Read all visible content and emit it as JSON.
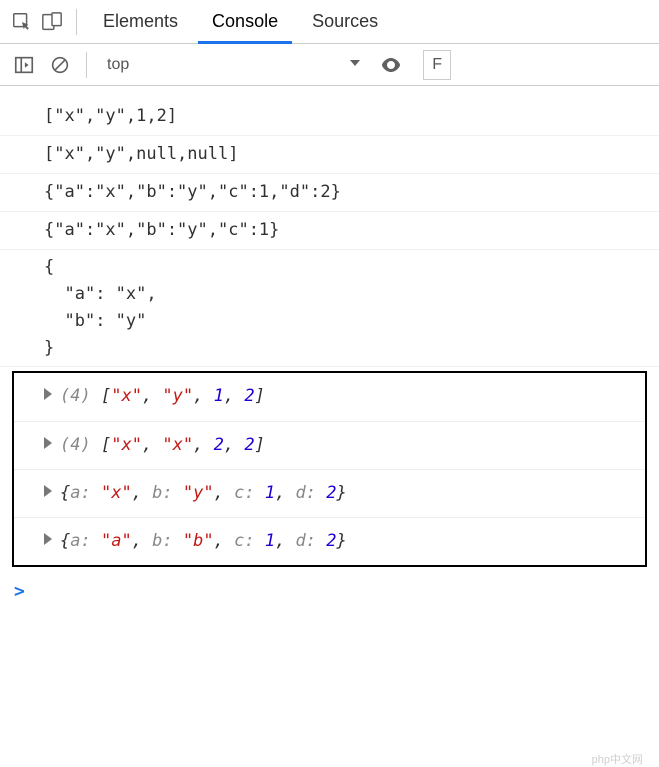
{
  "tabs": {
    "elements": "Elements",
    "console": "Console",
    "sources": "Sources"
  },
  "toolbar": {
    "context": "top",
    "filter_label": "F"
  },
  "logs": [
    "[\"x\",\"y\",1,2]",
    "[\"x\",\"y\",null,null]",
    "{\"a\":\"x\",\"b\":\"y\",\"c\":1,\"d\":2}",
    "{\"a\":\"x\",\"b\":\"y\",\"c\":1}",
    "{\n  \"a\": \"x\",\n  \"b\": \"y\"\n}"
  ],
  "boxed": [
    {
      "type": "array",
      "count": 4,
      "items": [
        {
          "v": "\"x\"",
          "t": "str"
        },
        {
          "v": "\"y\"",
          "t": "str"
        },
        {
          "v": "1",
          "t": "num"
        },
        {
          "v": "2",
          "t": "num"
        }
      ]
    },
    {
      "type": "array",
      "count": 4,
      "items": [
        {
          "v": "\"x\"",
          "t": "str"
        },
        {
          "v": "\"x\"",
          "t": "str"
        },
        {
          "v": "2",
          "t": "num"
        },
        {
          "v": "2",
          "t": "num"
        }
      ]
    },
    {
      "type": "object",
      "entries": [
        {
          "k": "a",
          "v": "\"x\"",
          "t": "str"
        },
        {
          "k": "b",
          "v": "\"y\"",
          "t": "str"
        },
        {
          "k": "c",
          "v": "1",
          "t": "num"
        },
        {
          "k": "d",
          "v": "2",
          "t": "num"
        }
      ]
    },
    {
      "type": "object",
      "entries": [
        {
          "k": "a",
          "v": "\"a\"",
          "t": "str"
        },
        {
          "k": "b",
          "v": "\"b\"",
          "t": "str"
        },
        {
          "k": "c",
          "v": "1",
          "t": "num"
        },
        {
          "k": "d",
          "v": "2",
          "t": "num"
        }
      ]
    }
  ],
  "prompt": ">",
  "watermark": "php中文网"
}
